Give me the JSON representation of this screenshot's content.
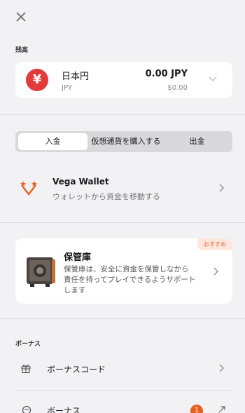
{
  "balance": {
    "section_label": "残高",
    "currency_symbol": "¥",
    "currency_name": "日本円",
    "currency_code": "JPY",
    "amount": "0.00 JPY",
    "usd_value": "$0.00"
  },
  "tabs": [
    {
      "label": "入金",
      "active": true
    },
    {
      "label": "仮想通貨を購入する",
      "active": false
    },
    {
      "label": "出金",
      "active": false
    }
  ],
  "vega": {
    "title": "Vega Wallet",
    "subtitle": "ウォレットから資金を移動する"
  },
  "vault": {
    "badge": "おすすめ",
    "title": "保管庫",
    "description_line1": "保管庫は、安全に資金を保管しなから",
    "description_line2": "責任を持ってプレイできるようサポート",
    "description_line3": "します"
  },
  "bonus": {
    "section_label": "ボーナス",
    "code_label": "ボーナスコード",
    "bonus_label": "ボーナス",
    "bonus_count": "1"
  },
  "colors": {
    "accent": "#e8611c",
    "yen_red": "#e23b3b"
  }
}
